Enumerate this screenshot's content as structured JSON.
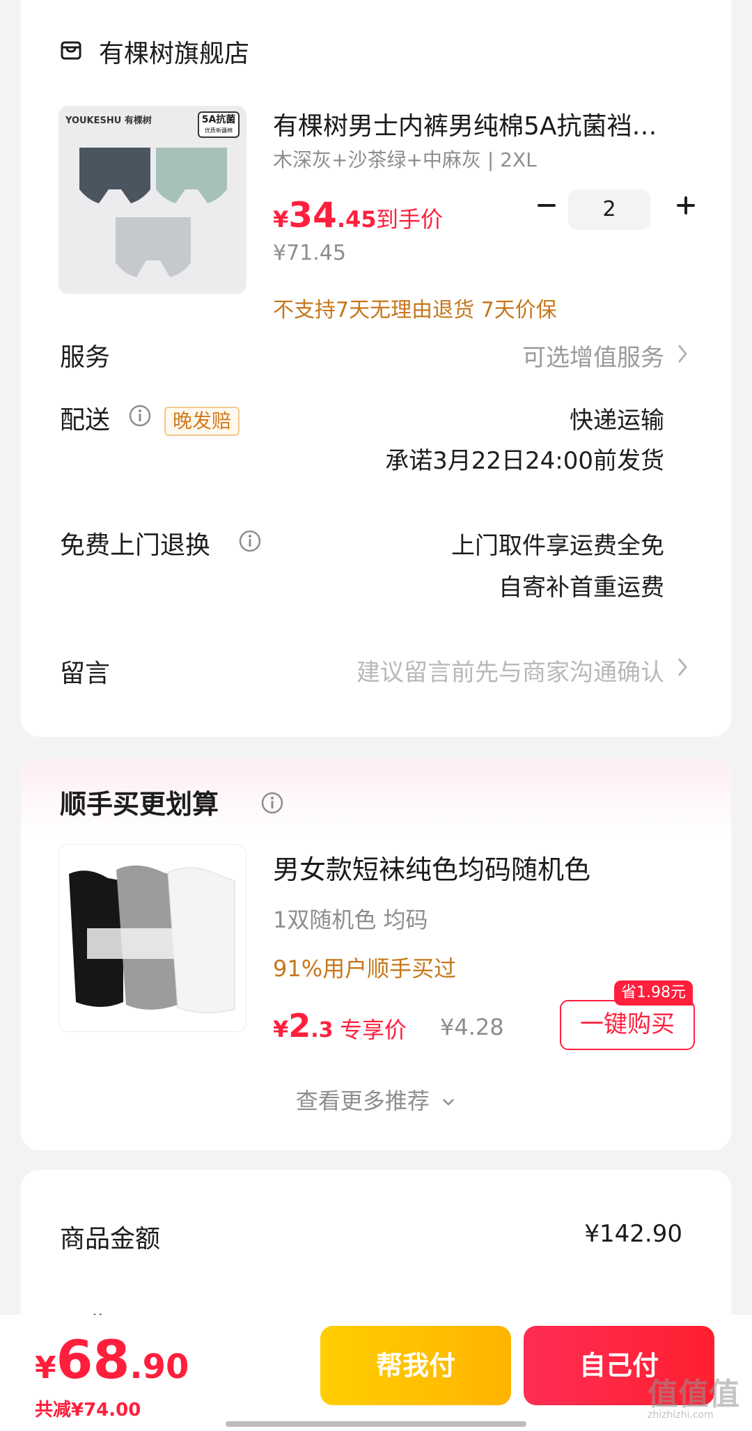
{
  "store": {
    "icon": "store-icon",
    "name": "有棵树旗舰店"
  },
  "product": {
    "image_brand": "YOUKESHU 有棵树",
    "image_badge_line1": "5A抗菌",
    "image_badge_line2": "优质新疆棉",
    "title": "有棵树男士内裤男纯棉5A抗菌裆…",
    "spec": "木深灰+沙茶绿+中麻灰 | 2XL",
    "price_symbol": "¥",
    "price_int": "34",
    "price_dec": ".45",
    "price_tag": "到手价",
    "original_price": "¥71.45",
    "quantity": "2",
    "policy": "不支持7天无理由退货  7天价保"
  },
  "rows": {
    "service_label": "服务",
    "service_value": "可选增值服务",
    "delivery_label": "配送",
    "delivery_badge": "晚发赔",
    "delivery_method": "快递运输",
    "delivery_promise": "承诺3月22日24:00前发货",
    "return_label": "免费上门退换",
    "return_line1": "上门取件享运费全免",
    "return_line2": "自寄补首重运费",
    "message_label": "留言",
    "message_placeholder": "建议留言前先与商家沟通确认"
  },
  "addon": {
    "title": "顺手买更划算",
    "name": "男女款短袜纯色均码随机色",
    "spec": "1双随机色    均码",
    "bought": "91%用户顺手买过",
    "price_symbol": "¥",
    "price_int": "2",
    "price_dec": ".3",
    "price_tag": "专享价",
    "original_price": "¥4.28",
    "save_badge": "省1.98元",
    "buy_label": "一键购买",
    "more_label": "查看更多推荐"
  },
  "summary": {
    "goods_amount_label": "商品金额",
    "goods_amount_value": "¥142.90",
    "next_label": "运费"
  },
  "bottom": {
    "total_symbol": "¥",
    "total_int": "68",
    "total_dec": ".90",
    "discount": "共减¥74.00",
    "pay_friend_label": "帮我付",
    "pay_self_label": "自己付"
  },
  "watermark": {
    "main": "值值值",
    "sub": "zhizhizhi.com"
  },
  "colors": {
    "accent_red": "#ff1f3d",
    "accent_orange": "#c6761a",
    "pay_friend_yellow": "#ffc300",
    "pay_self_red": "#ff2440"
  }
}
